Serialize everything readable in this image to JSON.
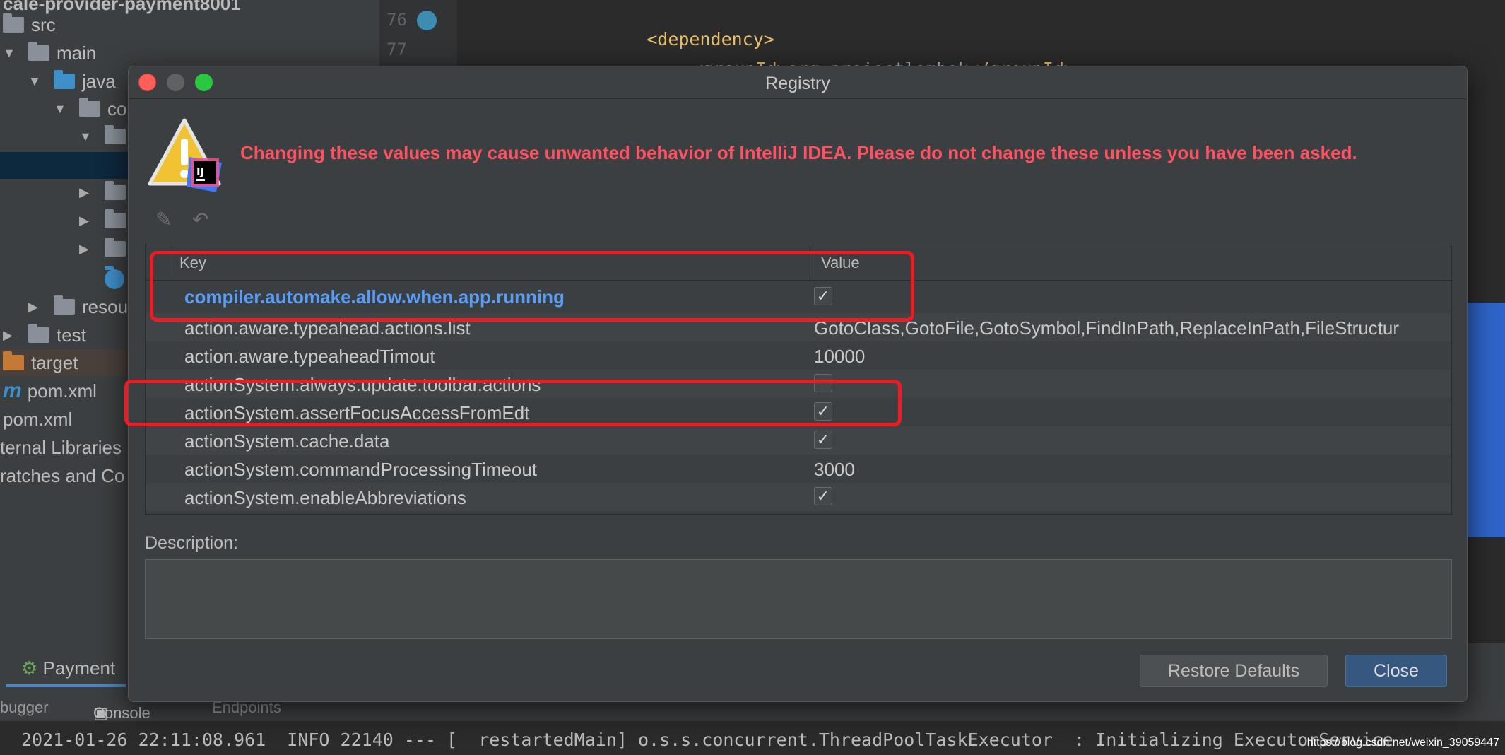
{
  "project_tree": {
    "header": "cale-provider-payment8001",
    "items": [
      {
        "label": "src"
      },
      {
        "label": "main"
      },
      {
        "label": "java"
      },
      {
        "label": "co"
      },
      {
        "label": "resou"
      },
      {
        "label": "test"
      },
      {
        "label": "target"
      },
      {
        "label": "pom.xml"
      },
      {
        "label": "pom.xml"
      },
      {
        "label": "ternal Libraries"
      },
      {
        "label": "ratches and Co"
      }
    ]
  },
  "editor": {
    "lines": [
      {
        "num": "76",
        "code_tag_open": "<dependency>"
      },
      {
        "num": "77",
        "code_tag_open": "<groupId>",
        "code_text": "org.projectlombok",
        "code_tag_close": "</groupId>"
      }
    ]
  },
  "bottom_panel": {
    "run_tab": "Payment",
    "tabs": [
      "bugger",
      "Console",
      "Endpoints"
    ],
    "log_line": "2021-01-26 22:11:08.961  INFO 22140 --- [  restartedMain] o.s.s.concurrent.ThreadPoolTaskExecutor  : Initializing ExecutorService"
  },
  "watermark": "https://blog.csdn.net/weixin_39059447",
  "dialog": {
    "title": "Registry",
    "warning": "Changing these values may cause unwanted behavior of IntelliJ IDEA. Please do not change these unless you have been asked.",
    "columns": {
      "key": "Key",
      "value": "Value"
    },
    "rows": [
      {
        "key": "compiler.automake.allow.when.app.running",
        "type": "checkbox",
        "checked": true,
        "modified": true
      },
      {
        "key": "action.aware.typeahead.actions.list",
        "type": "text",
        "value": "GotoClass,GotoFile,GotoSymbol,FindInPath,ReplaceInPath,FileStructur"
      },
      {
        "key": "action.aware.typeaheadTimout",
        "type": "text",
        "value": "10000"
      },
      {
        "key": "actionSystem.always.update.toolbar.actions",
        "type": "checkbox",
        "checked": false
      },
      {
        "key": "actionSystem.assertFocusAccessFromEdt",
        "type": "checkbox",
        "checked": true
      },
      {
        "key": "actionSystem.cache.data",
        "type": "checkbox",
        "checked": true
      },
      {
        "key": "actionSystem.commandProcessingTimeout",
        "type": "text",
        "value": "3000"
      },
      {
        "key": "actionSystem.enableAbbreviations",
        "type": "checkbox",
        "checked": true
      }
    ],
    "description_label": "Description:",
    "buttons": {
      "restore": "Restore Defaults",
      "close": "Close"
    }
  },
  "colors": {
    "warning_text": "#ff5261",
    "modified_key": "#589df6",
    "annotation_red": "#ec1c24",
    "primary_button": "#365880"
  }
}
